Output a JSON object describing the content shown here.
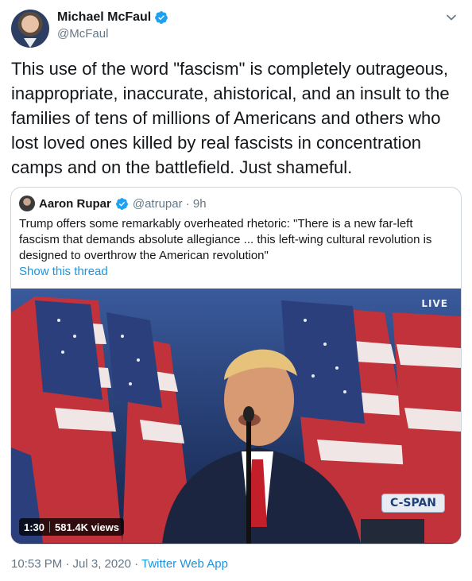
{
  "author": {
    "name": "Michael McFaul",
    "handle": "@McFaul",
    "avatar_icon": "profile-photo"
  },
  "tweet": {
    "text": "This use of the word \"fascism\" is completely outrageous, inappropriate, inaccurate, ahistorical, and an insult to the families of tens of millions of Americans and others who lost loved ones killed by real fascists in concentration camps and on the battlefield. Just shameful."
  },
  "quoted": {
    "name": "Aaron Rupar",
    "handle_time": "@atrupar · 9h",
    "text": "Trump offers some remarkably overheated rhetoric: \"There is a new far-left fascism that demands absolute allegiance ... this left-wing cultural revolution is designed to overthrow the American revolution\"",
    "show_thread": "Show this thread",
    "video": {
      "live_label": "LIVE",
      "network_label": "C-SPAN",
      "duration": "1:30",
      "views": "581.4K views"
    }
  },
  "footer": {
    "timestamp": "10:53 PM · Jul 3, 2020 · ",
    "app": "Twitter Web App"
  },
  "colors": {
    "link": "#1b95e0",
    "verified": "#1da1f2",
    "secondary_text": "#657786",
    "border": "#ccd6dd"
  }
}
